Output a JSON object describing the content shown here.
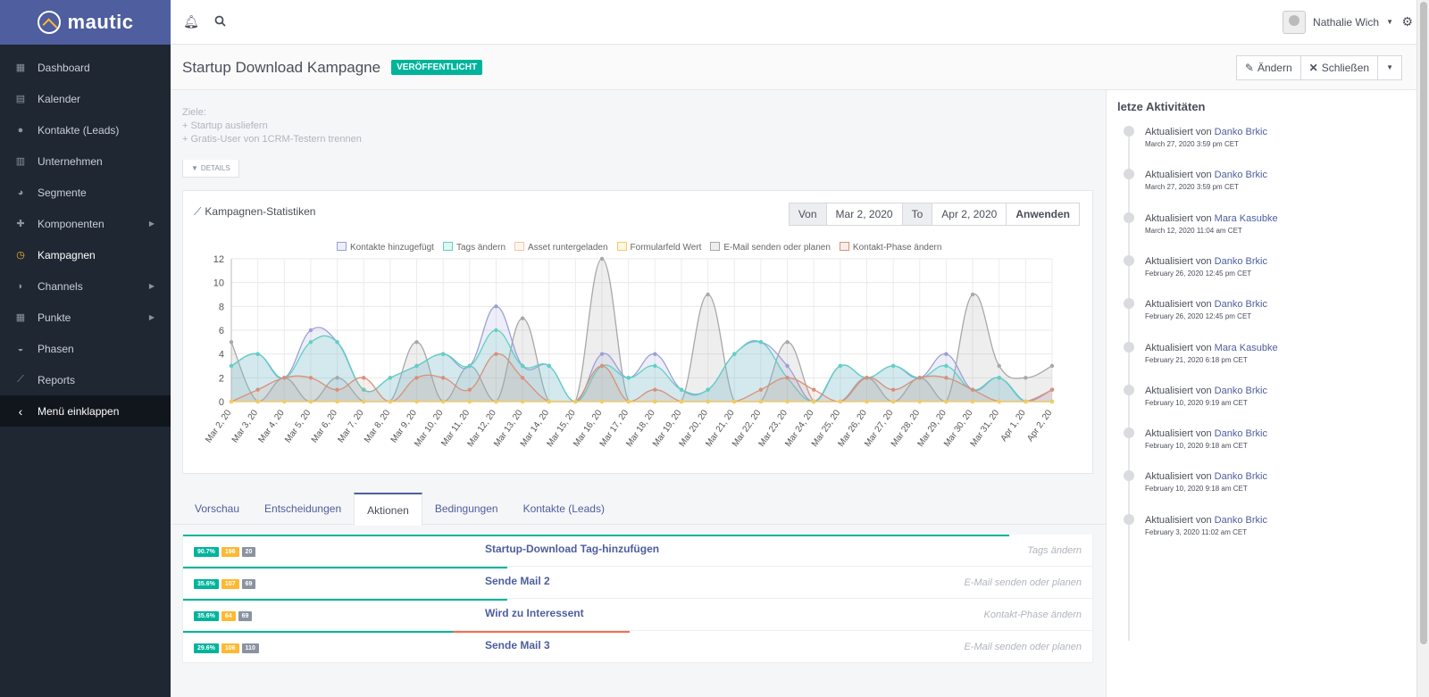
{
  "app": {
    "name": "mautic"
  },
  "sidebar": {
    "items": [
      {
        "label": "Dashboard",
        "icon": "grid-icon"
      },
      {
        "label": "Kalender",
        "icon": "calendar-icon"
      },
      {
        "label": "Kontakte (Leads)",
        "icon": "user-icon"
      },
      {
        "label": "Unternehmen",
        "icon": "building-icon"
      },
      {
        "label": "Segmente",
        "icon": "pie-chart-icon"
      },
      {
        "label": "Komponenten",
        "icon": "puzzle-icon"
      },
      {
        "label": "Kampagnen",
        "icon": "clock-icon"
      },
      {
        "label": "Channels",
        "icon": "rss-icon"
      },
      {
        "label": "Punkte",
        "icon": "calculator-icon"
      },
      {
        "label": "Phasen",
        "icon": "gauge-icon"
      },
      {
        "label": "Reports",
        "icon": "line-chart-icon"
      },
      {
        "label": "Menü einklappen",
        "icon": "chevron-left-icon"
      }
    ]
  },
  "topbar": {
    "user_name": "Nathalie Wich"
  },
  "header": {
    "title": "Startup Download Kampagne",
    "status": "VERÖFFENTLICHT",
    "edit_label": "Ändern",
    "close_label": "Schließen"
  },
  "goals": {
    "heading": "Ziele:",
    "line1": "+ Startup ausliefern",
    "line2": "+ Gratis-User von 1CRM-Testern trennen"
  },
  "details_label": "DETAILS",
  "stats": {
    "title": "Kampagnen-Statistiken",
    "from_label": "Von",
    "from_date": "Mar 2, 2020",
    "to_label": "To",
    "to_date": "Apr 2, 2020",
    "apply_label": "Anwenden"
  },
  "chart_data": {
    "type": "area",
    "x": [
      "Mar 2, 20",
      "Mar 3, 20",
      "Mar 4, 20",
      "Mar 5, 20",
      "Mar 6, 20",
      "Mar 7, 20",
      "Mar 8, 20",
      "Mar 9, 20",
      "Mar 10, 20",
      "Mar 11, 20",
      "Mar 12, 20",
      "Mar 13, 20",
      "Mar 14, 20",
      "Mar 15, 20",
      "Mar 16, 20",
      "Mar 17, 20",
      "Mar 18, 20",
      "Mar 19, 20",
      "Mar 20, 20",
      "Mar 21, 20",
      "Mar 22, 20",
      "Mar 23, 20",
      "Mar 24, 20",
      "Mar 25, 20",
      "Mar 26, 20",
      "Mar 27, 20",
      "Mar 28, 20",
      "Mar 29, 20",
      "Mar 30, 20",
      "Mar 31, 20",
      "Apr 1, 20",
      "Apr 2, 20"
    ],
    "ylim": [
      0,
      12
    ],
    "yticks": [
      0,
      2,
      4,
      6,
      8,
      10,
      12
    ],
    "series": [
      {
        "name": "Kontakte hinzugefügt",
        "color": "#9ba0d6",
        "fill": "rgba(155,160,214,0.18)",
        "values": [
          3,
          4,
          2,
          6,
          5,
          1,
          2,
          3,
          4,
          3,
          8,
          3,
          3,
          0,
          4,
          2,
          4,
          1,
          1,
          4,
          5,
          3,
          0,
          3,
          2,
          3,
          2,
          4,
          1,
          2,
          0,
          1
        ]
      },
      {
        "name": "Tags ändern",
        "color": "#5fd0c4",
        "fill": "rgba(95,208,196,0.18)",
        "values": [
          3,
          4,
          2,
          5,
          5,
          1,
          2,
          3,
          4,
          3,
          6,
          3,
          3,
          0,
          3,
          2,
          3,
          1,
          1,
          4,
          5,
          2,
          0,
          3,
          2,
          3,
          2,
          3,
          1,
          2,
          0,
          0
        ]
      },
      {
        "name": "Asset runtergeladen",
        "color": "#f5c79a",
        "fill": "rgba(245,199,154,0.15)",
        "values": [
          0,
          0,
          0,
          0,
          0,
          0,
          0,
          0,
          0,
          0,
          0,
          0,
          0,
          0,
          0,
          0,
          0,
          0,
          0,
          0,
          0,
          0,
          0,
          0,
          0,
          0,
          0,
          0,
          0,
          0,
          0,
          0
        ]
      },
      {
        "name": "Formularfeld Wert",
        "color": "#f2cc5e",
        "fill": "rgba(242,204,94,0.15)",
        "values": [
          0,
          0,
          0,
          0,
          0,
          0,
          0,
          0,
          0,
          0,
          0,
          0,
          0,
          0,
          0,
          0,
          0,
          0,
          0,
          0,
          0,
          0,
          0,
          0,
          0,
          0,
          0,
          0,
          0,
          0,
          0,
          0
        ]
      },
      {
        "name": "E-Mail senden oder planen",
        "color": "#a8a8a8",
        "fill": "rgba(168,168,168,0.2)",
        "values": [
          5,
          0,
          2,
          0,
          2,
          0,
          0,
          5,
          0,
          3,
          0,
          7,
          0,
          0,
          12,
          0,
          0,
          0,
          9,
          0,
          0,
          5,
          0,
          0,
          2,
          0,
          2,
          0,
          9,
          3,
          2,
          3
        ]
      },
      {
        "name": "Kontakt-Phase ändern",
        "color": "#d9907a",
        "fill": "rgba(217,144,122,0.15)",
        "values": [
          0,
          1,
          2,
          2,
          1,
          2,
          0,
          2,
          2,
          1,
          4,
          2,
          0,
          0,
          3,
          0,
          1,
          0,
          0,
          0,
          1,
          2,
          1,
          0,
          2,
          1,
          2,
          2,
          1,
          0,
          0,
          1
        ]
      }
    ]
  },
  "tabs": [
    {
      "label": "Vorschau"
    },
    {
      "label": "Entscheidungen"
    },
    {
      "label": "Aktionen"
    },
    {
      "label": "Bedingungen"
    },
    {
      "label": "Kontakte (Leads)"
    }
  ],
  "actions": [
    {
      "name": "Startup-Download Tag-hinzufügen",
      "type": "Tags ändern",
      "pct": "90.7%",
      "count1": "196",
      "count2": "20",
      "progress": 0.907,
      "fail": 0
    },
    {
      "name": "Sende Mail 2",
      "type": "E-Mail senden oder planen",
      "pct": "35.6%",
      "count1": "107",
      "count2": "69",
      "progress": 0.356,
      "fail": 0
    },
    {
      "name": "Wird zu Interessent",
      "type": "Kontakt-Phase ändern",
      "pct": "35.6%",
      "count1": "64",
      "count2": "69",
      "progress": 0.356,
      "fail": 0
    },
    {
      "name": "Sende Mail 3",
      "type": "E-Mail senden oder planen",
      "pct": "29.6%",
      "count1": "106",
      "count2": "110",
      "progress": 0.296,
      "fail": 0.194
    }
  ],
  "activity": {
    "title": "letze Aktivitäten",
    "prefix": "Aktualisiert von",
    "items": [
      {
        "user": "Danko Brkic",
        "time": "March 27, 2020 3:59 pm CET"
      },
      {
        "user": "Danko Brkic",
        "time": "March 27, 2020 3:59 pm CET"
      },
      {
        "user": "Mara Kasubke",
        "time": "March 12, 2020 11:04 am CET"
      },
      {
        "user": "Danko Brkic",
        "time": "February 26, 2020 12:45 pm CET"
      },
      {
        "user": "Danko Brkic",
        "time": "February 26, 2020 12:45 pm CET"
      },
      {
        "user": "Mara Kasubke",
        "time": "February 21, 2020 6:18 pm CET"
      },
      {
        "user": "Danko Brkic",
        "time": "February 10, 2020 9:19 am CET"
      },
      {
        "user": "Danko Brkic",
        "time": "February 10, 2020 9:18 am CET"
      },
      {
        "user": "Danko Brkic",
        "time": "February 10, 2020 9:18 am CET"
      },
      {
        "user": "Danko Brkic",
        "time": "February 3, 2020 11:02 am CET"
      }
    ]
  }
}
